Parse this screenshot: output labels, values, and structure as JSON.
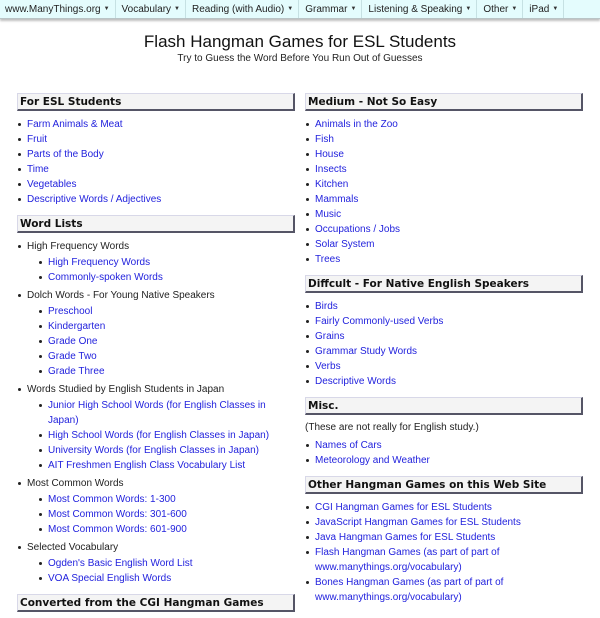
{
  "navbar": {
    "items": [
      {
        "label": "www.ManyThings.org",
        "caret": "▼"
      },
      {
        "label": "Vocabulary",
        "caret": "▼"
      },
      {
        "label": "Reading (with Audio)",
        "caret": "▼"
      },
      {
        "label": "Grammar",
        "caret": "▼"
      },
      {
        "label": "Listening & Speaking",
        "caret": "▼"
      },
      {
        "label": "Other",
        "caret": "▼"
      },
      {
        "label": "iPad",
        "caret": "▼"
      }
    ]
  },
  "header": {
    "title": "Flash Hangman Games for ESL Students",
    "subtitle": "Try to Guess the Word Before You Run Out of Guesses"
  },
  "left": {
    "esl": {
      "heading": "For ESL Students",
      "links": [
        "Farm Animals & Meat",
        "Fruit",
        "Parts of the Body",
        "Time",
        "Vegetables",
        "Descriptive Words / Adjectives"
      ]
    },
    "word_lists": {
      "heading": "Word Lists",
      "groups": [
        {
          "label": "High Frequency Words",
          "links": [
            "High Frequency Words",
            "Commonly-spoken Words"
          ]
        },
        {
          "label": "Dolch Words - For Young Native Speakers",
          "links": [
            "Preschool",
            "Kindergarten",
            "Grade One",
            "Grade Two",
            "Grade Three"
          ]
        },
        {
          "label": "Words Studied by English Students in Japan",
          "links": [
            "Junior High School Words (for English Classes in Japan)",
            "High School Words (for English Classes in Japan)",
            "University Words (for English Classes in Japan)",
            "AIT Freshmen English Class Vocabulary List"
          ]
        },
        {
          "label": "Most Common Words",
          "links": [
            "Most Common Words: 1-300",
            "Most Common Words: 301-600",
            "Most Common Words: 601-900"
          ]
        },
        {
          "label": "Selected Vocabulary",
          "links": [
            "Ogden's Basic English Word List",
            "VOA Special English Words"
          ]
        }
      ]
    },
    "converted": {
      "heading": "Converted from the CGI Hangman Games"
    }
  },
  "right": {
    "medium": {
      "heading": "Medium - Not So Easy",
      "links": [
        "Animals in the Zoo",
        "Fish",
        "House",
        "Insects",
        "Kitchen",
        "Mammals",
        "Music",
        "Occupations / Jobs",
        "Solar System",
        "Trees"
      ]
    },
    "difficult": {
      "heading": "Diffcult - For Native English Speakers",
      "links": [
        "Birds",
        "Fairly Commonly-used Verbs",
        "Grains",
        "Grammar Study Words",
        "Verbs",
        "Descriptive Words"
      ]
    },
    "misc": {
      "heading": "Misc.",
      "note": "(These are not really for English study.)",
      "links": [
        "Names of Cars",
        "Meteorology and Weather"
      ]
    },
    "other": {
      "heading": "Other Hangman Games on this Web Site",
      "links": [
        "CGI Hangman Games for ESL Students",
        "JavaScript Hangman Games for ESL Students",
        "Java Hangman Games for ESL Students",
        "Flash Hangman Games (as part of part of www.manythings.org/vocabulary)",
        "Bones Hangman Games (as part of part of www.manythings.org/vocabulary)"
      ]
    }
  },
  "colors": {
    "link": "#2222dd",
    "navbar_bg": "#e4fcfd"
  }
}
